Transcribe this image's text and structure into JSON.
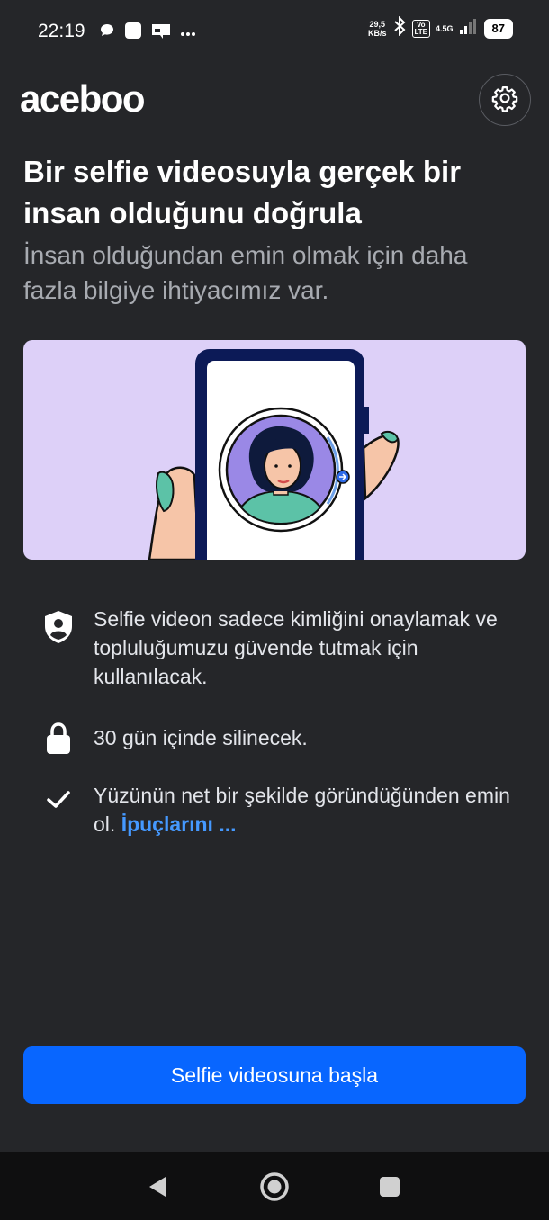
{
  "status_bar": {
    "time": "22:19",
    "speed_value": "29,5",
    "speed_unit": "KB/s",
    "volte_top": "Vo",
    "volte_bottom": "LTE",
    "network": "4.5G",
    "battery": "87",
    "icons": [
      "chat-bubble-icon",
      "notification-square-icon",
      "notification-flag-icon",
      "more-dots-icon",
      "bluetooth-icon",
      "signal-icon"
    ]
  },
  "header": {
    "logo": "aceboo",
    "settings_icon": "gear-icon"
  },
  "main": {
    "title": "Bir selfie videosuyla gerçek bir insan olduğunu doğrula",
    "subtitle": "İnsan olduğundan emin olmak için daha fazla bilgiye ihtiyacımız var."
  },
  "info_items": [
    {
      "icon": "shield-person-icon",
      "text": "Selfie videon sadece kimliğini onaylamak ve topluluğumuzu güvende tutmak için kullanılacak."
    },
    {
      "icon": "lock-icon",
      "text": "30 gün içinde silinecek."
    },
    {
      "icon": "checkmark-icon",
      "text": "Yüzünün net bir şekilde göründüğünden emin ol. ",
      "link": "İpuçlarını ..."
    }
  ],
  "cta": {
    "label": "Selfie videosuna başla"
  },
  "nav": {
    "icons": [
      "back-icon",
      "home-icon",
      "recents-icon"
    ]
  },
  "colors": {
    "background": "#252629",
    "accent": "#0866ff",
    "link": "#4599ff",
    "illustration_bg": "#ddd0f8"
  }
}
